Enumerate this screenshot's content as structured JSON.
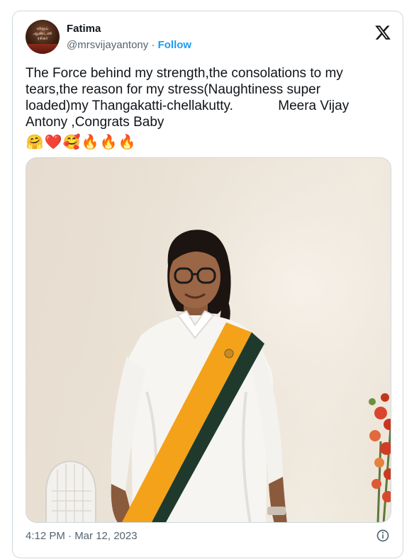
{
  "tweet": {
    "author_name": "Fatima",
    "handle": "@mrsvijayantony",
    "separator": "·",
    "follow_label": "Follow",
    "avatar_caption": "விஜய் ஆண்டனி ரசிகர்",
    "text": "The Force behind my strength,the consolations to my tears,the reason for my stress(Naughtiness super loaded)my Thangakatti-chellakutty.            Meera Vijay Antony ,Congrats Baby",
    "emojis": [
      "🤗",
      "❤️",
      "🥰",
      "🔥",
      "🔥",
      "🔥"
    ],
    "timestamp": "4:12 PM · Mar 12, 2023",
    "media_alt": "Photo of a smiling girl wearing a white school uniform with a yellow and green sash"
  },
  "colors": {
    "text_primary": "#0f1419",
    "text_secondary": "#536471",
    "link": "#1d9bf0",
    "border": "#cfd9de",
    "sash_yellow": "#f4a21a",
    "sash_green": "#1f3a2c"
  },
  "icons": {
    "platform_logo": "x-logo-icon",
    "info": "info-icon"
  }
}
